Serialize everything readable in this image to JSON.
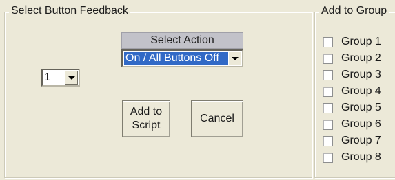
{
  "feedback": {
    "legend": "Select Button Feedback",
    "action_header": "Select Action",
    "action_selected": "On / All Buttons Off",
    "number_selected": "1",
    "add_label_line1": "Add to",
    "add_label_line2": "Script",
    "cancel_label": "Cancel"
  },
  "groups": {
    "legend": "Add to Group",
    "items": [
      {
        "label": "Group 1",
        "checked": false
      },
      {
        "label": "Group 2",
        "checked": false
      },
      {
        "label": "Group 3",
        "checked": false
      },
      {
        "label": "Group 4",
        "checked": false
      },
      {
        "label": "Group 5",
        "checked": false
      },
      {
        "label": "Group 6",
        "checked": false
      },
      {
        "label": "Group 7",
        "checked": false
      },
      {
        "label": "Group 8",
        "checked": false
      }
    ]
  },
  "colors": {
    "background": "#ece9d8",
    "selection": "#3169c6",
    "header_bg": "#c2c2c9"
  }
}
